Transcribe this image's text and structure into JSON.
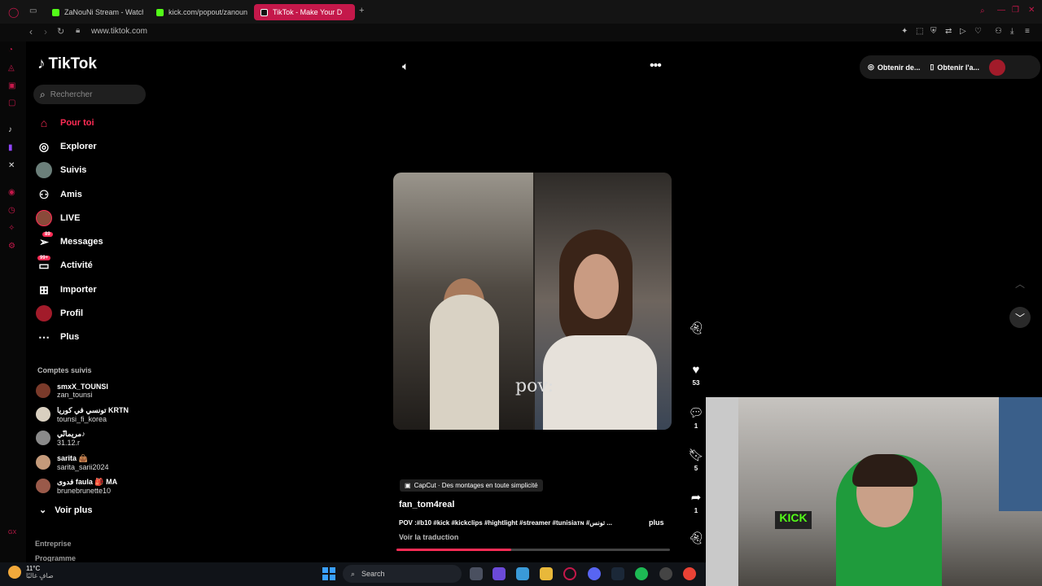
{
  "browser": {
    "tabs": [
      {
        "label": "ZaNouNi Stream - Watch"
      },
      {
        "label": "kick.com/popout/zanoun"
      },
      {
        "label": "TikTok - Make Your D"
      }
    ],
    "new_tab": "+",
    "url": "www.tiktok.com"
  },
  "sidebar": {
    "logo": "TikTok",
    "search_placeholder": "Rechercher",
    "nav": [
      {
        "label": "Pour toi",
        "icon": "home-icon"
      },
      {
        "label": "Explorer",
        "icon": "compass-icon"
      },
      {
        "label": "Suivis",
        "icon": "avatar-icon"
      },
      {
        "label": "Amis",
        "icon": "friends-icon"
      },
      {
        "label": "LIVE",
        "icon": "live-avatar-icon"
      },
      {
        "label": "Messages",
        "icon": "send-icon",
        "badge": "89"
      },
      {
        "label": "Activité",
        "icon": "inbox-icon",
        "badge": "99+"
      },
      {
        "label": "Importer",
        "icon": "upload-icon"
      },
      {
        "label": "Profil",
        "icon": "profile-avatar-icon"
      },
      {
        "label": "Plus",
        "icon": "more-icon"
      }
    ],
    "followed_title": "Comptes suivis",
    "followed": [
      {
        "name": "smxX_TOUNSI",
        "handle": "zan_tounsi"
      },
      {
        "name": "تونسي في كوريا KRTN",
        "handle": "tounsi_fi_korea"
      },
      {
        "name": "مريمانّي♪",
        "handle": "31.12.r"
      },
      {
        "name": "sarita 👜",
        "handle": "sarita_sarii2024"
      },
      {
        "name": "ف‍دوى faula 🎒 MA",
        "handle": "brunebrunette10"
      }
    ],
    "see_more": "Voir plus",
    "footer": [
      "Entreprise",
      "Programme"
    ]
  },
  "topbar": {
    "get_coins": "Obtenir de...",
    "get_app": "Obtenir l'a..."
  },
  "video": {
    "overlay_text": "pov:",
    "capcut": "CapCut · Des montages en toute simplicité",
    "author": "fan_tom4real",
    "description": "POV :#b10 #kick #kickclips #hightlight #streamer #tunisiaᴛɴ #تونس ...",
    "more": "plus",
    "translate": "Voir la traduction",
    "progress": 0.42
  },
  "actions": {
    "likes": "53",
    "comments": "1",
    "saves": "5",
    "shares": "1"
  },
  "taskbar": {
    "temp": "11°C",
    "weather_desc": "صافٍ غالبًا",
    "search": "Search"
  },
  "colors": {
    "accent": "#fe2c55",
    "tab_active": "#c4184a",
    "kick_green": "#53fc18"
  }
}
